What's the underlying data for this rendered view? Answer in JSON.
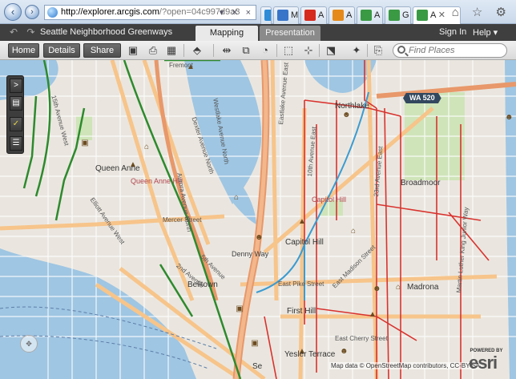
{
  "browser": {
    "url_host": "http://explorer.arcgis.com",
    "url_rest": "/?open=04c997d9a3",
    "tabs": [
      "M",
      "A",
      "A",
      "A",
      "G",
      "A"
    ],
    "address_buttons": "▾ ✕ ×",
    "window_icons": "⌂ ☆ ⚙"
  },
  "app": {
    "title": "Seattle Neighborhood Greenways",
    "undo_icon": "↶ ↷",
    "mode_tabs": [
      "Mapping",
      "Presentation"
    ],
    "sign_in": "Sign In",
    "help": "Help ▾"
  },
  "toolbar": {
    "buttons": [
      "Home",
      "Details",
      "Share"
    ],
    "search_placeholder": "Find Places",
    "icons": [
      "save-icon",
      "print-icon",
      "layout-icon",
      "bookmark-icon",
      "measure-icon",
      "basemap-icon",
      "gauge-icon",
      "select-icon",
      "identify-icon",
      "zoom-select-icon",
      "layers-icon",
      "share-icon"
    ]
  },
  "map": {
    "controls": [
      ">",
      "▤",
      "✓",
      "☰"
    ],
    "pan_glyph": "✥",
    "hoods": [
      "Queen Anne",
      "Belltown",
      "Capitol Hill",
      "Broadmoor",
      "Madrona",
      "First Hill",
      "Yesler Terrace",
      "Northlake",
      "Denny Way",
      "Se"
    ],
    "pink_labels": [
      "Queen Anne Hill",
      "Capitol Hill"
    ],
    "roads": [
      "Dexter Avenue North",
      "Westlake Avenue North",
      "Aurora Avenue North",
      "Eastlake Avenue East",
      "10th Avenue East",
      "East Madison Street",
      "23rd Avenue East",
      "Martin Luther King Junior Way",
      "East Pike Street",
      "East Cherry Street",
      "Mercer Street",
      "Elliott Avenue West",
      "15th Avenue West",
      "2nd Avenue",
      "5th Avenue",
      "Fremont"
    ],
    "shield_520": "WA 520",
    "attribution": "Map data © OpenStreetMap contributors, CC-BY-SA",
    "esri_powered": "POWERED BY",
    "esri_word": "esri"
  },
  "colors": {
    "water": "#9fc6e3",
    "highway": "#f7c48a",
    "greenway": "#2d8a2d",
    "bike_route": "#d9322e",
    "park": "#cfe4b9"
  }
}
